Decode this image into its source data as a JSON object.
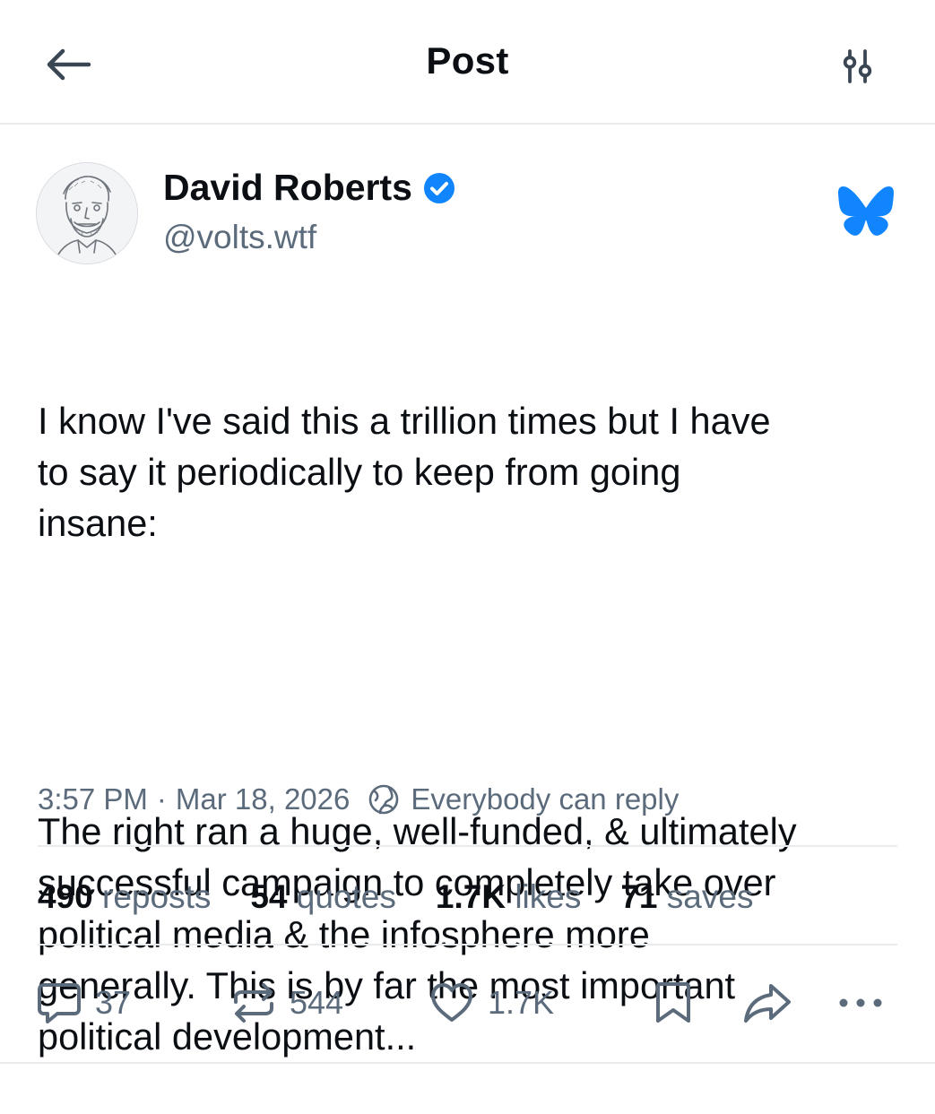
{
  "header": {
    "title": "Post"
  },
  "author": {
    "name": "David Roberts",
    "handle": "@volts.wtf",
    "verified": true
  },
  "post": {
    "paragraph1": "I know I've said this a trillion times but I have\nto say it periodically to keep from going\ninsane:",
    "paragraph2": "The right ran a huge, well-funded, & ultimately\nsuccessful campaign to completely take over\npolitical media & the infosphere more\ngenerally. This is by far the most important\npolitical development..."
  },
  "meta": {
    "time": "3:57 PM",
    "separator": "·",
    "date": "Mar 18, 2026",
    "reply_setting": "Everybody can reply"
  },
  "stats": {
    "reposts": {
      "count": "490",
      "label": "reposts"
    },
    "quotes": {
      "count": "54",
      "label": "quotes"
    },
    "likes": {
      "count": "1.7K",
      "label": "likes"
    },
    "saves": {
      "count": "71",
      "label": "saves"
    }
  },
  "actions": {
    "reply_count": "37",
    "repost_count": "544",
    "like_count": "1.7K"
  },
  "colors": {
    "text": "#0b0f14",
    "secondary": "#5b6b7c",
    "accent": "#1185fe",
    "divider": "#e9ecef"
  },
  "icons": {
    "back": "arrow-left-icon",
    "settings": "sliders-icon",
    "verified": "verified-check-icon",
    "brand": "bluesky-butterfly-icon",
    "reply_setting": "globe-icon",
    "reply": "speech-bubble-icon",
    "repost": "repost-arrows-icon",
    "like": "heart-icon",
    "save": "bookmark-icon",
    "share": "share-arrow-icon",
    "more": "ellipsis-icon"
  }
}
